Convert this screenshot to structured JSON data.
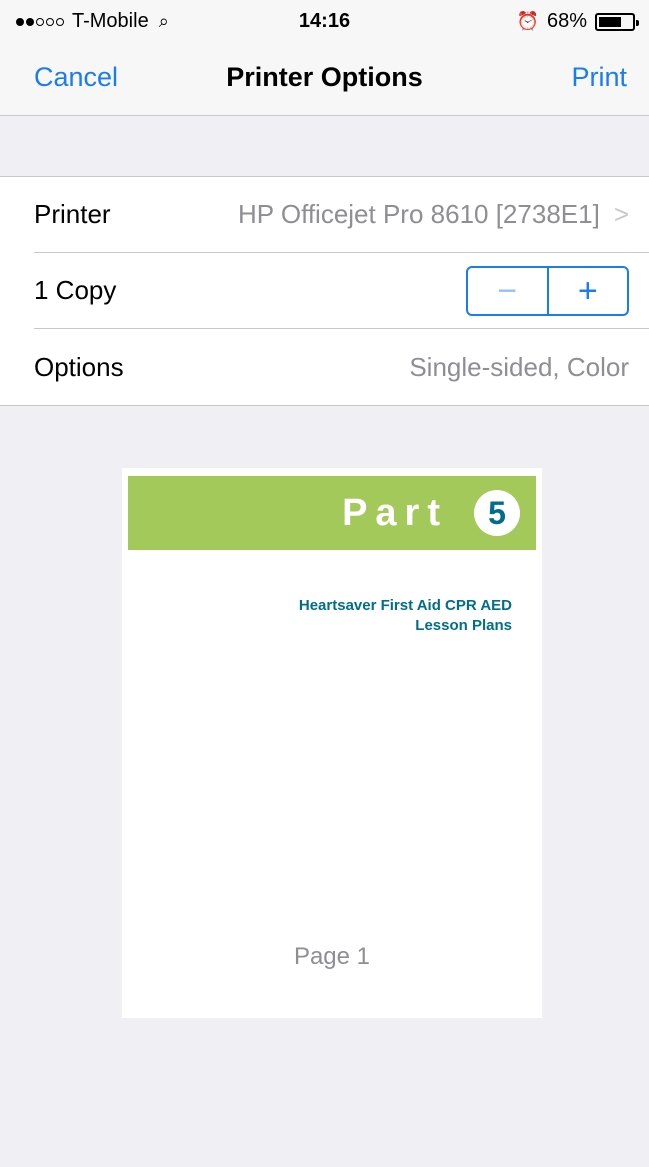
{
  "status_bar": {
    "carrier": "T-Mobile",
    "time": "14:16",
    "battery_percent": "68%",
    "battery_level": 0.68,
    "signal_strength": 2
  },
  "nav": {
    "cancel_label": "Cancel",
    "title": "Printer Options",
    "print_label": "Print"
  },
  "settings": {
    "printer": {
      "label": "Printer",
      "value": "HP Officejet Pro 8610 [2738E1]"
    },
    "copies": {
      "label": "1 Copy",
      "minus": "−",
      "plus": "+"
    },
    "options": {
      "label": "Options",
      "value": "Single-sided, Color"
    }
  },
  "preview": {
    "banner_text": "Part",
    "banner_number": "5",
    "doc_title_line1": "Heartsaver First Aid CPR AED",
    "doc_title_line2": "Lesson Plans",
    "page_label": "Page 1"
  },
  "colors": {
    "accent": "#1a7cf0",
    "banner_green": "#a4c95b",
    "doc_teal": "#006e8a"
  }
}
